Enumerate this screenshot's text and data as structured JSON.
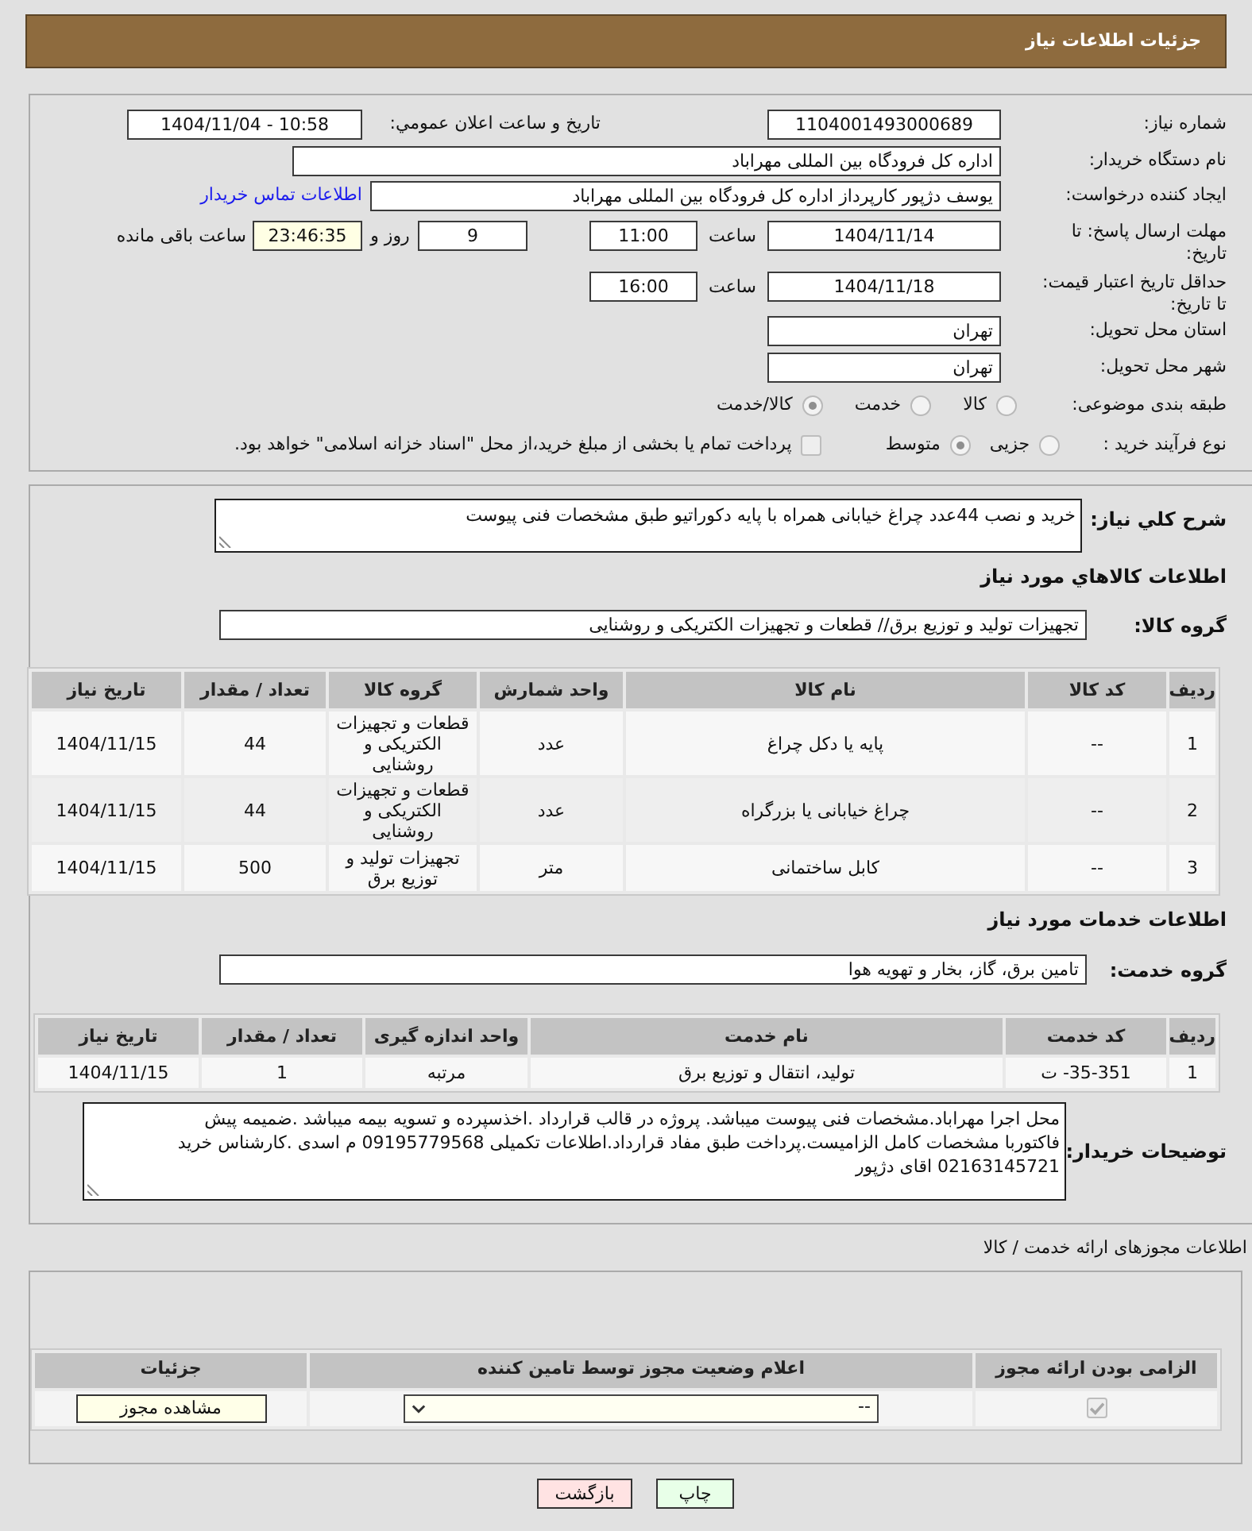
{
  "header": {
    "title": "جزئیات اطلاعات نیاز"
  },
  "summary": {
    "need_number": {
      "label": "شماره نیاز:",
      "value": "1104001493000689"
    },
    "announcement": {
      "label": "تاریخ و ساعت اعلان عمومي:",
      "value": "1404/11/04 - 10:58"
    },
    "buyer_org": {
      "label": "نام دستگاه خریدار:",
      "value": "اداره کل فرودگاه بین المللی مهراباد"
    },
    "requester": {
      "label": "ایجاد کننده درخواست:",
      "value": "یوسف دژپور کارپرداز اداره کل فرودگاه بین المللی مهراباد",
      "link": "اطلاعات تماس خریدار"
    },
    "reply_deadline": {
      "label": "مهلت ارسال پاسخ: تا تاریخ:",
      "date": "1404/11/14",
      "time_label": "ساعت",
      "time": "11:00",
      "days": "9",
      "days_label": "روز و",
      "remaining": "23:46:35",
      "remaining_label": "ساعت باقی مانده"
    },
    "price_validity": {
      "label": "حداقل تاریخ اعتبار قیمت: تا تاریخ:",
      "date": "1404/11/18",
      "time_label": "ساعت",
      "time": "16:00"
    },
    "province": {
      "label": "استان محل تحویل:",
      "value": "تهران"
    },
    "city": {
      "label": "شهر محل تحویل:",
      "value": "تهران"
    },
    "category": {
      "label": "طبقه بندی موضوعی:",
      "options": [
        {
          "label": "کالا",
          "selected": false
        },
        {
          "label": "خدمت",
          "selected": false
        },
        {
          "label": "کالا/خدمت",
          "selected": true
        }
      ]
    },
    "process": {
      "label": "نوع فرآیند خرید :",
      "options": [
        {
          "label": "جزیی",
          "selected": false
        },
        {
          "label": "متوسط",
          "selected": true
        }
      ],
      "treasury_payment": {
        "label": "پرداخت تمام یا بخشی از مبلغ خرید،از محل \"اسناد خزانه اسلامی\" خواهد بود.",
        "checked": false
      }
    }
  },
  "description": {
    "label": "شرح کلي نیاز:",
    "value": "خرید و نصب 44عدد چراغ خیابانی همراه با پایه دکوراتیو طبق مشخصات فنی پیوست"
  },
  "goods": {
    "title": "اطلاعات کالاهاي مورد نیاز",
    "group_label": "گروه کالا:",
    "group": "تجهیزات تولید و توزیع برق// قطعات و تجهیزات الکتریکی و روشنایی",
    "table": {
      "columns": [
        "ردیف",
        "کد کالا",
        "نام کالا",
        "واحد شمارش",
        "گروه کالا",
        "تعداد / مقدار",
        "تاریخ نیاز"
      ],
      "rows": [
        [
          "1",
          "--",
          "پایه یا دکل چراغ",
          "عدد",
          "قطعات و تجهیزات الکتریکی و روشنایی",
          "44",
          "1404/11/15"
        ],
        [
          "2",
          "--",
          "چراغ خیابانی یا بزرگراه",
          "عدد",
          "قطعات و تجهیزات الکتریکی و روشنایی",
          "44",
          "1404/11/15"
        ],
        [
          "3",
          "--",
          "کابل ساختمانی",
          "متر",
          "تجهیزات تولید و توزیع برق",
          "500",
          "1404/11/15"
        ]
      ]
    }
  },
  "services": {
    "title": "اطلاعات خدمات مورد نیاز",
    "group_label": "گروه خدمت:",
    "group": "تامین برق، گاز، بخار و تهویه هوا",
    "table": {
      "columns": [
        "ردیف",
        "کد خدمت",
        "نام خدمت",
        "واحد اندازه گیری",
        "تعداد / مقدار",
        "تاریخ نیاز"
      ],
      "rows": [
        [
          "1",
          "35-351- ت",
          "تولید، انتقال و توزیع برق",
          "مرتبه",
          "1",
          "1404/11/15"
        ]
      ]
    }
  },
  "buyer_notes": {
    "label": "توضیحات خریدار:",
    "value": "محل اجرا مهراباد.مشخصات فنی پیوست میباشد. پروژه در قالب قرارداد .اخذسپرده و تسویه بیمه میباشد .ضمیمه پیش فاکتوربا مشخصات کامل الزامیست.پرداخت طبق مفاد قرارداد.اطلاعات تکمیلی 09195779568 م اسدی .کارشناس خرید 02163145721 اقای دژپور"
  },
  "permits": {
    "title": "اطلاعات مجوزهای ارائه خدمت / کالا",
    "columns": [
      "الزامی بودن ارائه مجوز",
      "اعلام وضعیت مجوز توسط تامین کننده",
      "جزئیات"
    ],
    "rows": [
      {
        "required": true,
        "status": "--",
        "button": "مشاهده مجوز"
      }
    ]
  },
  "buttons": [
    {
      "label": "چاپ",
      "kind": "print"
    },
    {
      "label": "بازگشت",
      "kind": "back"
    }
  ]
}
